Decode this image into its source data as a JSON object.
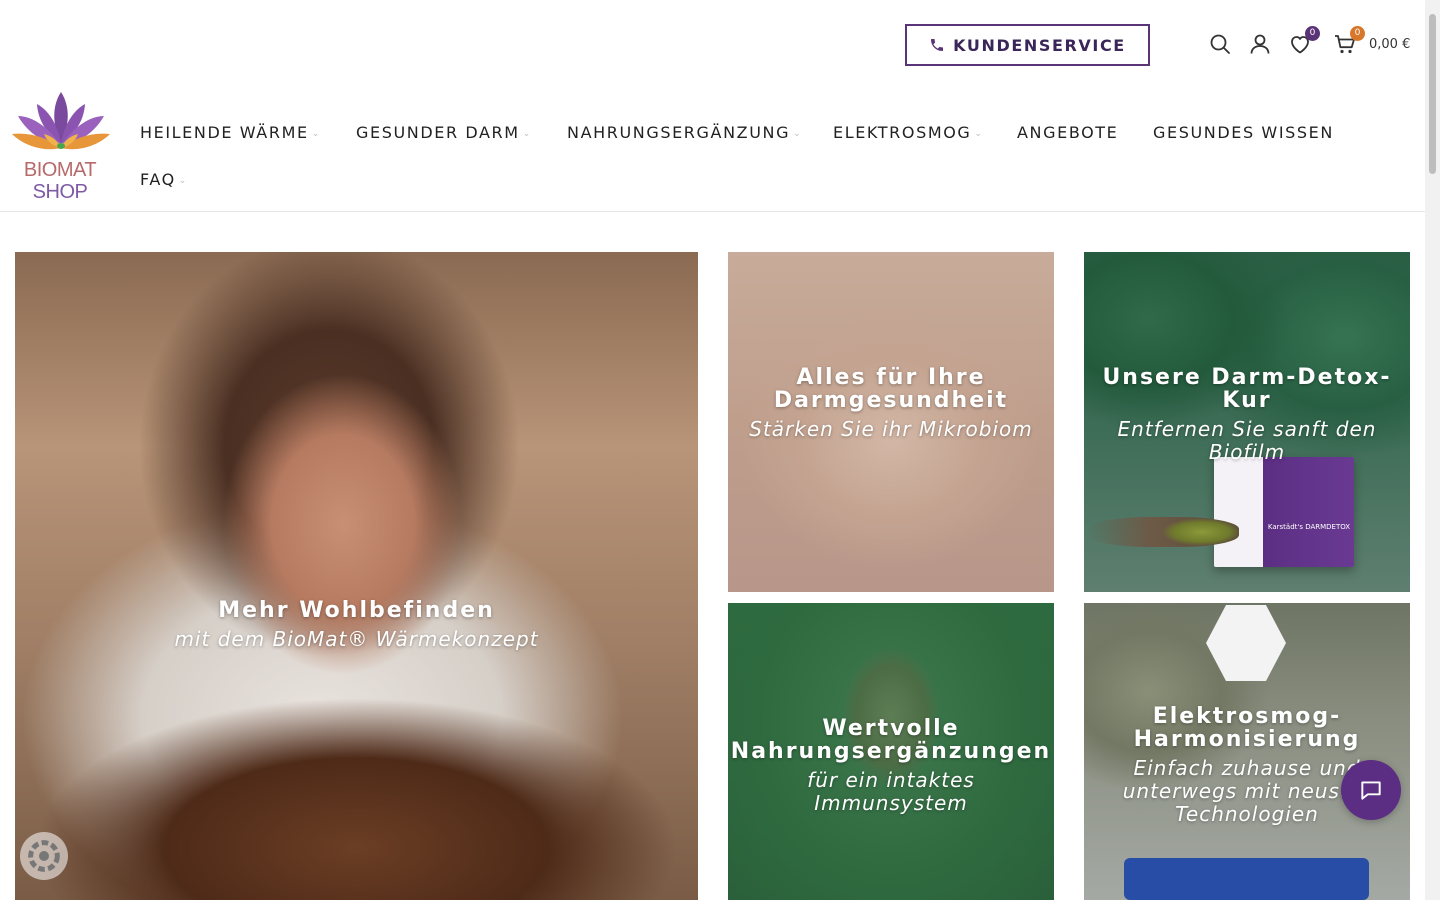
{
  "header": {
    "service_label": "KUNDENSERVICE",
    "wishlist_count": "0",
    "cart_count": "0",
    "cart_total": "0,00 €",
    "accent_color": "#5b3478",
    "wishlist_badge_color": "#5b3478",
    "cart_badge_color": "#d8772a",
    "icons": [
      "phone-icon",
      "search-icon",
      "user-icon",
      "heart-icon",
      "cart-icon"
    ]
  },
  "logo": {
    "line1": "BIOMAT",
    "line2": "SHOP"
  },
  "nav": {
    "items": [
      {
        "label": "HEILENDE WÄRME",
        "has_dropdown": true
      },
      {
        "label": "GESUNDER DARM",
        "has_dropdown": true
      },
      {
        "label": "NAHRUNGSERGÄNZUNG",
        "has_dropdown": true
      },
      {
        "label": "ELEKTROSMOG",
        "has_dropdown": true
      },
      {
        "label": "ANGEBOTE",
        "has_dropdown": false
      },
      {
        "label": "GESUNDES WISSEN",
        "has_dropdown": false
      },
      {
        "label": "FAQ",
        "has_dropdown": true
      }
    ]
  },
  "tiles": [
    {
      "title": "Mehr Wohlbefinden",
      "subtitle": "mit dem BioMat® Wärmekonzept"
    },
    {
      "title": "Alles für Ihre Darmgesundheit",
      "subtitle": "Stärken Sie ihr Mikrobiom"
    },
    {
      "title": "Unsere Darm-Detox-Kur",
      "subtitle": "Entfernen Sie sanft den Biofilm",
      "product_label": "Karstädt's DARMDETOX"
    },
    {
      "title": "Wertvolle Nahrungsergänzungen",
      "subtitle": "für ein intaktes Immunsystem"
    },
    {
      "title": "Elektrosmog-Harmonisierung",
      "subtitle": "Einfach zuhause und unterwegs mit neuster Technologien"
    }
  ],
  "widgets": {
    "chat_icon": "chat-bubble-icon",
    "cookie_icon": "cookie-settings-icon"
  }
}
